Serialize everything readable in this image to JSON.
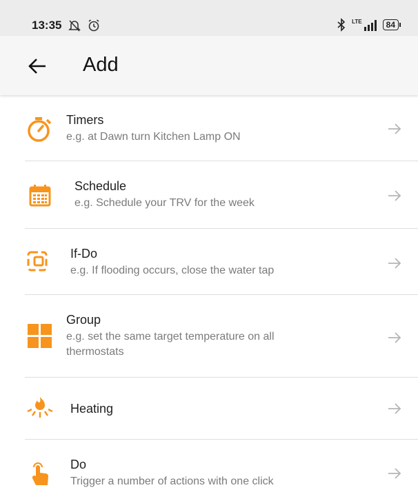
{
  "status_bar": {
    "time": "13:35",
    "network": "LTE",
    "battery": "84",
    "icons": [
      "notifications-off-icon",
      "alarm-icon",
      "bluetooth-icon",
      "signal-icon",
      "battery-icon"
    ]
  },
  "app_bar": {
    "title": "Add",
    "back_icon": "arrow-left-icon"
  },
  "colors": {
    "accent": "#F7941D",
    "arrow": "#B5B5B5",
    "divider": "#DEDEDE"
  },
  "items": [
    {
      "title": "Timers",
      "subtitle": "e.g. at Dawn turn Kitchen Lamp ON",
      "icon": "stopwatch-icon"
    },
    {
      "title": "Schedule",
      "subtitle": "e.g. Schedule your TRV for the week",
      "icon": "calendar-icon"
    },
    {
      "title": "If-Do",
      "subtitle": "e.g. If flooding occurs, close the water tap",
      "icon": "if-do-icon"
    },
    {
      "title": "Group",
      "subtitle": "e.g. set the same target temperature on all thermostats",
      "icon": "grid-icon"
    },
    {
      "title": "Heating",
      "subtitle": "",
      "icon": "flame-icon"
    },
    {
      "title": "Do",
      "subtitle": "Trigger a number of actions with one click",
      "icon": "tap-hand-icon"
    }
  ]
}
